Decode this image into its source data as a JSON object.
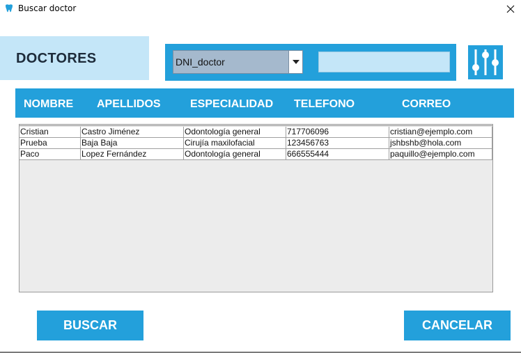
{
  "window": {
    "title": "Buscar doctor",
    "close_glyph": "✕"
  },
  "header": {
    "title": "DOCTORES"
  },
  "search": {
    "field_selected": "DNI_doctor",
    "value": "",
    "placeholder": ""
  },
  "icons": {
    "app": "tooth-icon",
    "filter": "sliders-icon",
    "dropdown": "chevron-down-icon",
    "close": "close-icon"
  },
  "columns": [
    "NOMBRE",
    "APELLIDOS",
    "ESPECIALIDAD",
    "TELEFONO",
    "CORREO"
  ],
  "rows": [
    [
      "Cristian",
      "Castro Jiménez",
      "Odontología general",
      "717706096",
      "cristian@ejemplo.com"
    ],
    [
      "Prueba",
      "Baja Baja",
      "Cirujía maxilofacial",
      "123456763",
      "jshbshb@hola.com"
    ],
    [
      "Paco",
      "Lopez Fernández",
      "Odontología general",
      "666555444",
      "paquillo@ejemplo.com"
    ]
  ],
  "buttons": {
    "search": "BUSCAR",
    "cancel": "CANCELAR"
  },
  "colors": {
    "accent": "#23a0db",
    "light_accent": "#c4e6f8",
    "combo": "#a5b9cd",
    "table_bg": "#ececec"
  }
}
